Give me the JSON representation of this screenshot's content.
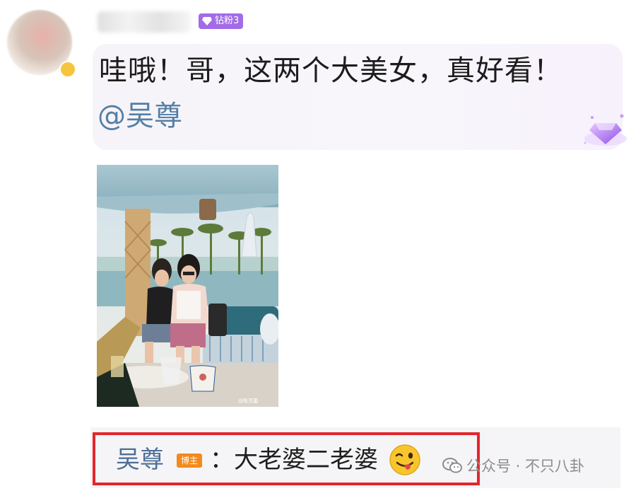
{
  "comment": {
    "fan_badge": "钻粉3",
    "text": "哇哦！哥，这两个大美女，真好看！",
    "mention": "@吴尊"
  },
  "photo": {
    "watermark": "@陈芳蕾"
  },
  "reply": {
    "author": "吴尊",
    "owner_tag": "博主",
    "text": "：大老婆二老婆",
    "emoji": "winking-tongue-emoji"
  },
  "watermark": {
    "text": "公众号 · 不只八卦",
    "icon": "wechat-icon"
  },
  "colors": {
    "mention": "#547fa6",
    "badge": "#a26be7",
    "highlight_box": "#e4262c",
    "owner_tag": "#f48a1c"
  }
}
